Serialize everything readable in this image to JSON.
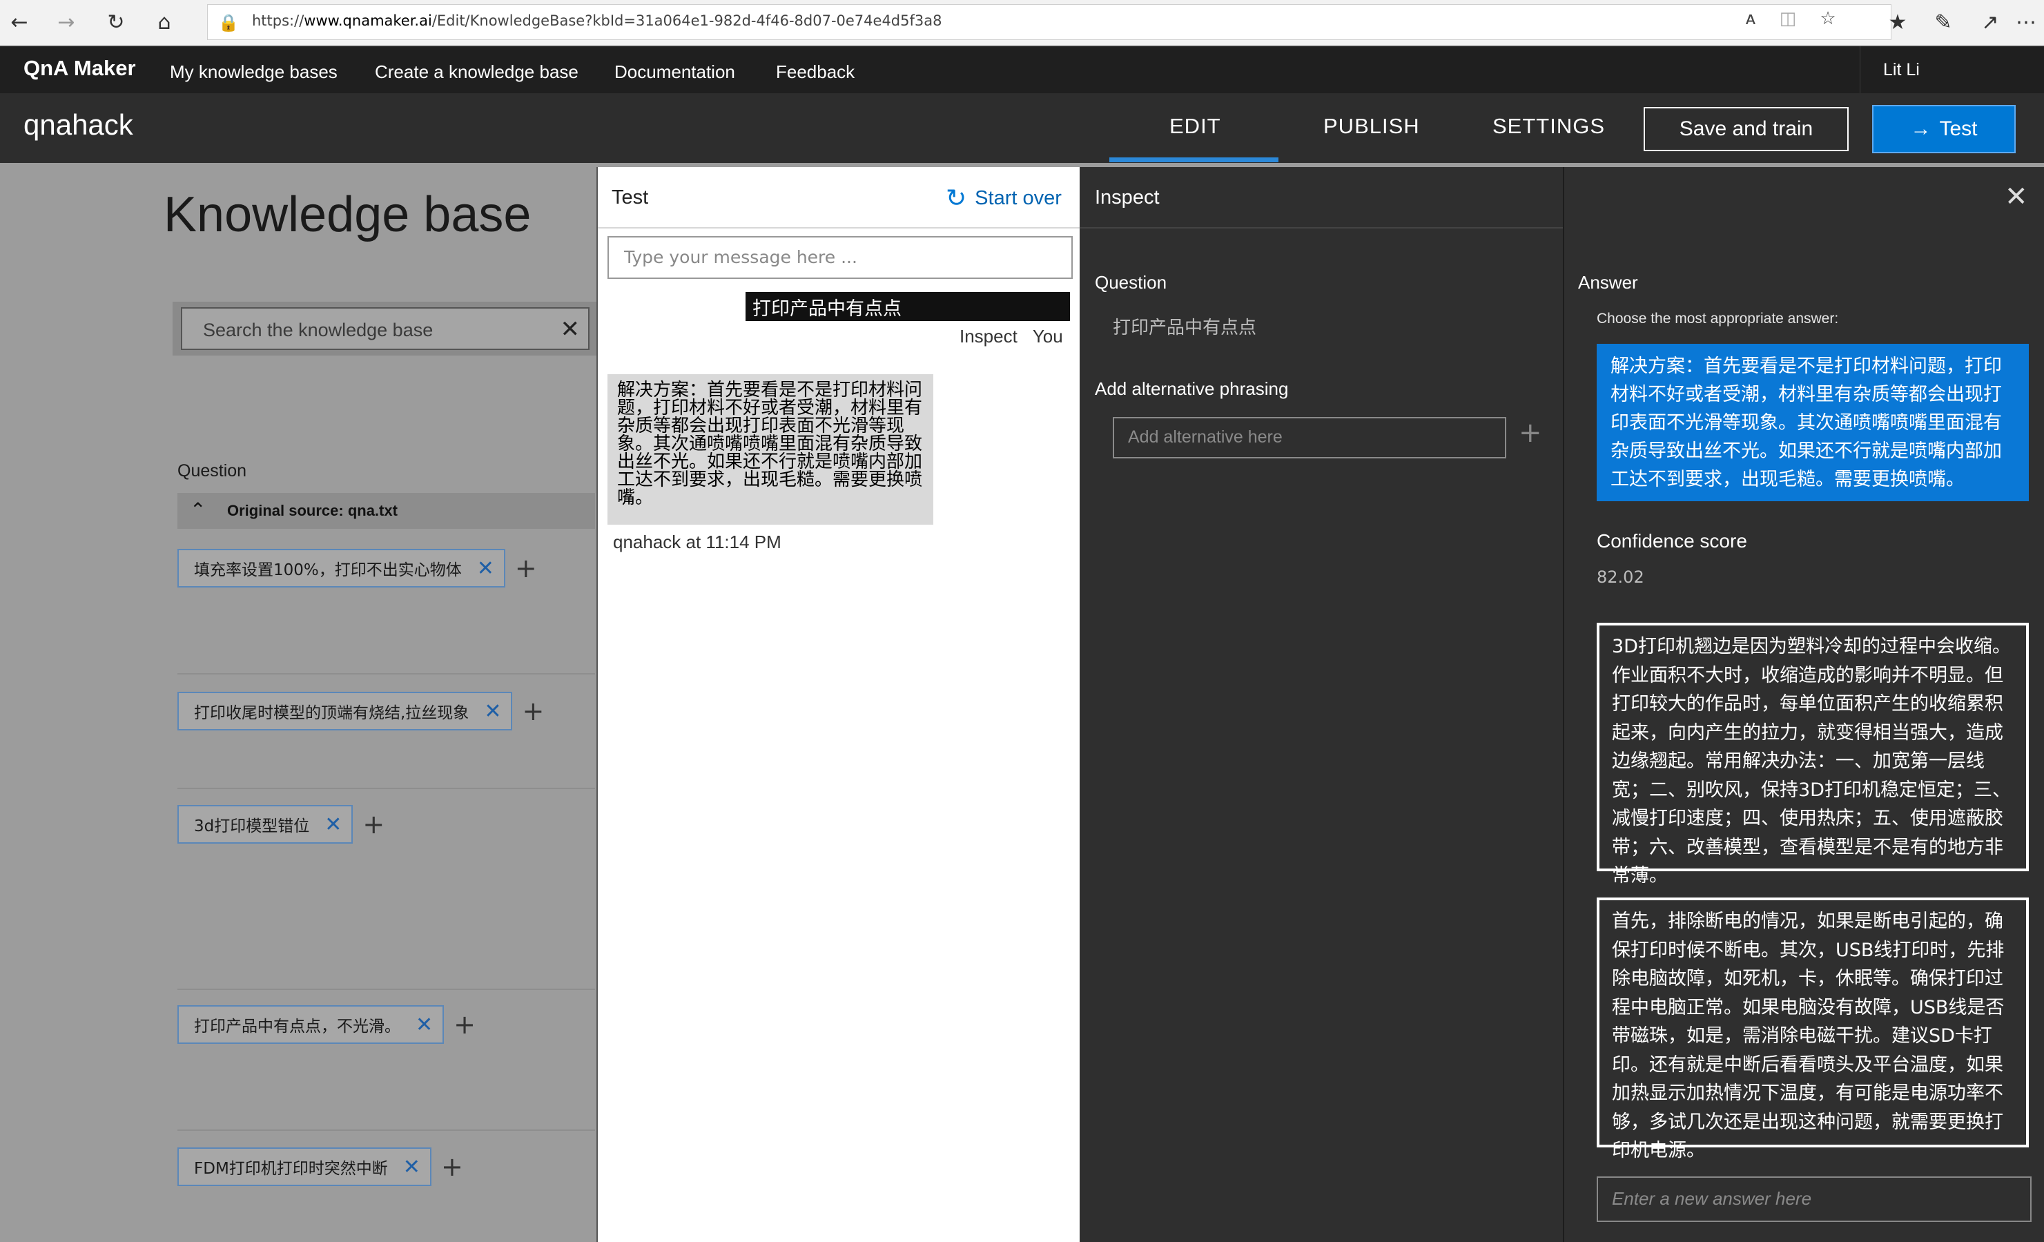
{
  "browser": {
    "url_prefix": "https://",
    "url_host": "www.qnamaker.ai",
    "url_path": "/Edit/KnowledgeBase?kbId=31a064e1-982d-4f46-8d07-0e74e4d5f3a8"
  },
  "topnav": {
    "brand": "QnA Maker",
    "links": [
      "My knowledge bases",
      "Create a knowledge base",
      "Documentation",
      "Feedback"
    ],
    "user": "Lit Li"
  },
  "kbbar": {
    "name": "qnahack",
    "tabs": [
      "EDIT",
      "PUBLISH",
      "SETTINGS"
    ],
    "active_tab": "EDIT",
    "save_label": "Save and train",
    "test_label": "Test"
  },
  "kb": {
    "title": "Knowledge base",
    "search_placeholder": "Search the knowledge base",
    "question_header": "Question",
    "source_label": "Original source: qna.txt",
    "questions": [
      "填充率设置100%，打印不出实心物体",
      "打印收尾时模型的顶端有烧结,拉丝现象",
      "3d打印模型错位",
      "打印产品中有点点，不光滑。",
      "FDM打印机打印时突然中断"
    ]
  },
  "test": {
    "title": "Test",
    "start_over": "Start over",
    "input_placeholder": "Type your message here ...",
    "user_message": "打印产品中有点点",
    "inspect_link": "Inspect",
    "you_label": "You",
    "bot_reply": "解决方案：首先要看是不是打印材料问题，打印材料不好或者受潮，材料里有杂质等都会出现打印表面不光滑等现象。其次通喷嘴喷嘴里面混有杂质导致出丝不光。如果还不行就是喷嘴内部加工达不到要求，出现毛糙。需要更换喷嘴。",
    "bot_meta": "qnahack at 11:14 PM"
  },
  "inspect": {
    "title": "Inspect",
    "question_label": "Question",
    "question_value": "打印产品中有点点",
    "alt_label": "Add alternative phrasing",
    "alt_placeholder": "Add alternative here",
    "answer_label": "Answer",
    "answer_hint": "Choose the most appropriate answer:",
    "selected_answer": "解决方案：首先要看是不是打印材料问题，打印材料不好或者受潮，材料里有杂质等都会出现打印表面不光滑等现象。其次通喷嘴喷嘴里面混有杂质导致出丝不光。如果还不行就是喷嘴内部加工达不到要求，出现毛糙。需要更换喷嘴。",
    "confidence_label": "Confidence score",
    "confidence_value": "82.02",
    "candidates": [
      "3D打印机翘边是因为塑料冷却的过程中会收缩。作业面积不大时，收缩造成的影响并不明显。但打印较大的作品时，每单位面积产生的收缩累积起来，向内产生的拉力，就变得相当强大，造成边缘翘起。常用解决办法：一、加宽第一层线宽；二、别吹风，保持3D打印机稳定恒定；三、减慢打印速度；四、使用热床；五、使用遮蔽胶带；六、改善模型，查看模型是不是有的地方非常薄。",
      "首先，排除断电的情况，如果是断电引起的，确保打印时候不断电。其次，USB线打印时，先排除电脑故障，如死机，卡，休眠等。确保打印过程中电脑正常。如果电脑没有故障，USB线是否带磁珠，如是，需消除电磁干扰。建议SD卡打印。还有就是中断后看看喷头及平台温度，如果加热显示加热情况下温度，有可能是电源功率不够，多试几次还是出现这种问题，就需要更换打印机电源。"
    ],
    "new_answer_placeholder": "Enter a new answer here"
  },
  "colors": {
    "accent": "#0078d4",
    "nav_bg": "#1f1f1f",
    "kbbar_bg": "#2d2d2d",
    "inspect_bg": "#2f2f2f"
  }
}
